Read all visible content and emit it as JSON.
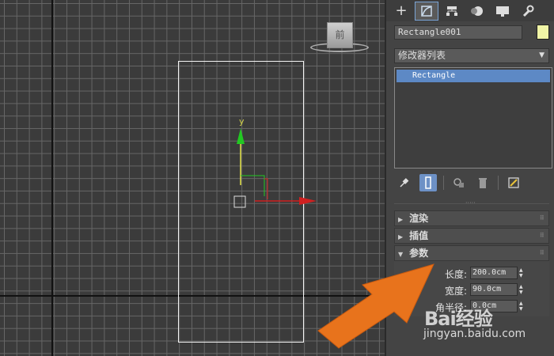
{
  "viewport": {
    "viewcube_label": "前",
    "gizmo_y_label": "y"
  },
  "panel": {
    "tabs": [
      {
        "icon": "plus-icon"
      },
      {
        "icon": "modify-icon"
      },
      {
        "icon": "hierarchy-icon"
      },
      {
        "icon": "motion-icon"
      },
      {
        "icon": "display-icon"
      },
      {
        "icon": "utilities-icon"
      }
    ],
    "object_name": "Rectangle001",
    "object_color": "#f0f4a6",
    "modifier_list_label": "修改器列表",
    "stack_items": [
      "Rectangle"
    ],
    "rollouts": {
      "render": "渲染",
      "interpolation": "插值",
      "parameters": "参数"
    },
    "params": [
      {
        "label": "长度:",
        "value": "200.0cm"
      },
      {
        "label": "宽度:",
        "value": "90.0cm"
      },
      {
        "label": "角半径:",
        "value": "0.0cm"
      }
    ]
  },
  "watermark": {
    "logo": "Bai经验",
    "url": "jingyan.baidu.com"
  },
  "colors": {
    "accent": "#5d89c5",
    "arrow": "#e8731c"
  }
}
